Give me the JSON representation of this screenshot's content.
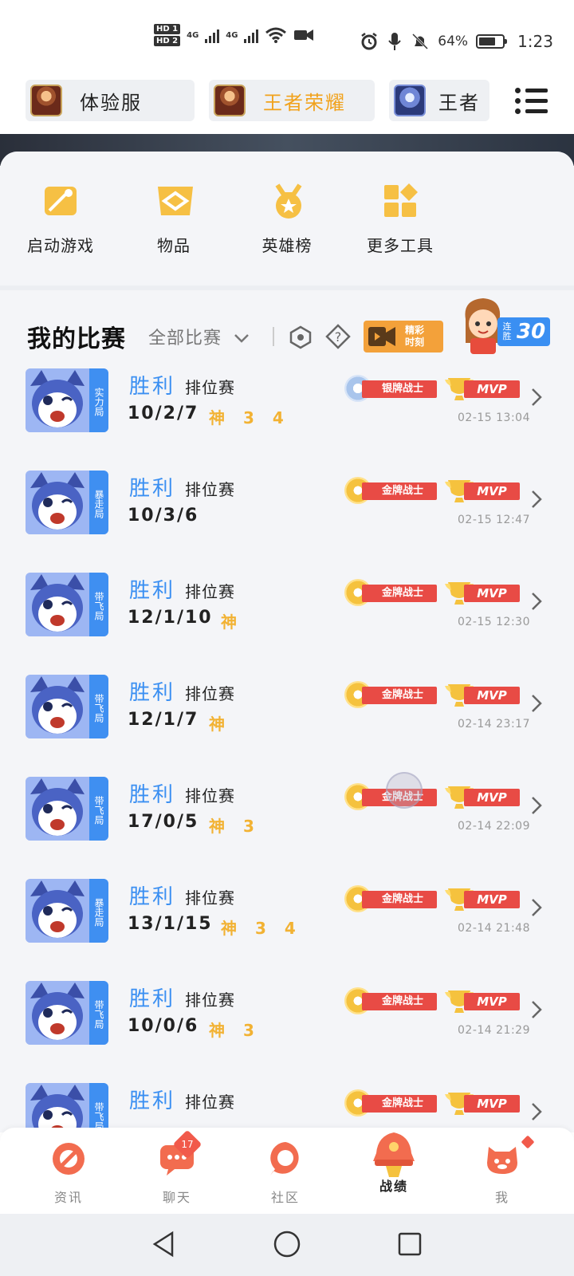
{
  "status_bar": {
    "hd1": "HD 1",
    "hd2": "HD 2",
    "net1": "4G",
    "net2": "4G",
    "battery": "64%",
    "time": "1:23"
  },
  "game_tabs": [
    {
      "label": "体验服",
      "active": false
    },
    {
      "label": "王者荣耀",
      "active": true
    },
    {
      "label": "王者",
      "active": false
    }
  ],
  "tools": [
    {
      "label": "启动游戏",
      "icon": "launch-game-icon"
    },
    {
      "label": "物品",
      "icon": "items-icon"
    },
    {
      "label": "英雄榜",
      "icon": "hero-rank-icon"
    },
    {
      "label": "更多工具",
      "icon": "more-tools-icon"
    }
  ],
  "matches_header": {
    "title": "我的比赛",
    "filter": "全部比赛",
    "highlight_line1": "精彩",
    "highlight_line2": "时刻",
    "streak_label": "连胜",
    "streak_count": "30"
  },
  "matches": [
    {
      "tag": "实力局",
      "result": "胜利",
      "type": "排位赛",
      "kda": "10/2/7",
      "marks": "神 3 4",
      "medal": "银牌战士",
      "medal_kind": "silver",
      "mvp": "MVP",
      "time": "02-15 13:04"
    },
    {
      "tag": "暴走局",
      "result": "胜利",
      "type": "排位赛",
      "kda": "10/3/6",
      "marks": "",
      "medal": "金牌战士",
      "medal_kind": "gold",
      "mvp": "MVP",
      "time": "02-15 12:47"
    },
    {
      "tag": "带飞局",
      "result": "胜利",
      "type": "排位赛",
      "kda": "12/1/10",
      "marks": "神",
      "medal": "金牌战士",
      "medal_kind": "gold",
      "mvp": "MVP",
      "time": "02-15 12:30"
    },
    {
      "tag": "带飞局",
      "result": "胜利",
      "type": "排位赛",
      "kda": "12/1/7",
      "marks": "神",
      "medal": "金牌战士",
      "medal_kind": "gold",
      "mvp": "MVP",
      "time": "02-14 23:17"
    },
    {
      "tag": "带飞局",
      "result": "胜利",
      "type": "排位赛",
      "kda": "17/0/5",
      "marks": "神 3",
      "medal": "金牌战士",
      "medal_kind": "gold",
      "mvp": "MVP",
      "time": "02-14 22:09"
    },
    {
      "tag": "暴走局",
      "result": "胜利",
      "type": "排位赛",
      "kda": "13/1/15",
      "marks": "神 3 4",
      "medal": "金牌战士",
      "medal_kind": "gold",
      "mvp": "MVP",
      "time": "02-14 21:48"
    },
    {
      "tag": "带飞局",
      "result": "胜利",
      "type": "排位赛",
      "kda": "10/0/6",
      "marks": "神 3",
      "medal": "金牌战士",
      "medal_kind": "gold",
      "mvp": "MVP",
      "time": "02-14 21:29"
    },
    {
      "tag": "带飞局",
      "result": "胜利",
      "type": "排位赛",
      "kda": "",
      "marks": "",
      "medal": "金牌战士",
      "medal_kind": "gold",
      "mvp": "MVP",
      "time": ""
    }
  ],
  "bottom_nav": [
    {
      "label": "资讯",
      "icon": "news-icon",
      "active": false,
      "badge": ""
    },
    {
      "label": "聊天",
      "icon": "chat-icon",
      "active": false,
      "badge": "17"
    },
    {
      "label": "社区",
      "icon": "community-icon",
      "active": false,
      "badge": ""
    },
    {
      "label": "战绩",
      "icon": "records-icon",
      "active": true,
      "badge": ""
    },
    {
      "label": "我",
      "icon": "me-icon",
      "active": false,
      "badge": "dot"
    }
  ],
  "colors": {
    "accent_blue": "#3a8ff2",
    "accent_gold": "#f1a21c",
    "ribbon_red": "#e84b45"
  }
}
